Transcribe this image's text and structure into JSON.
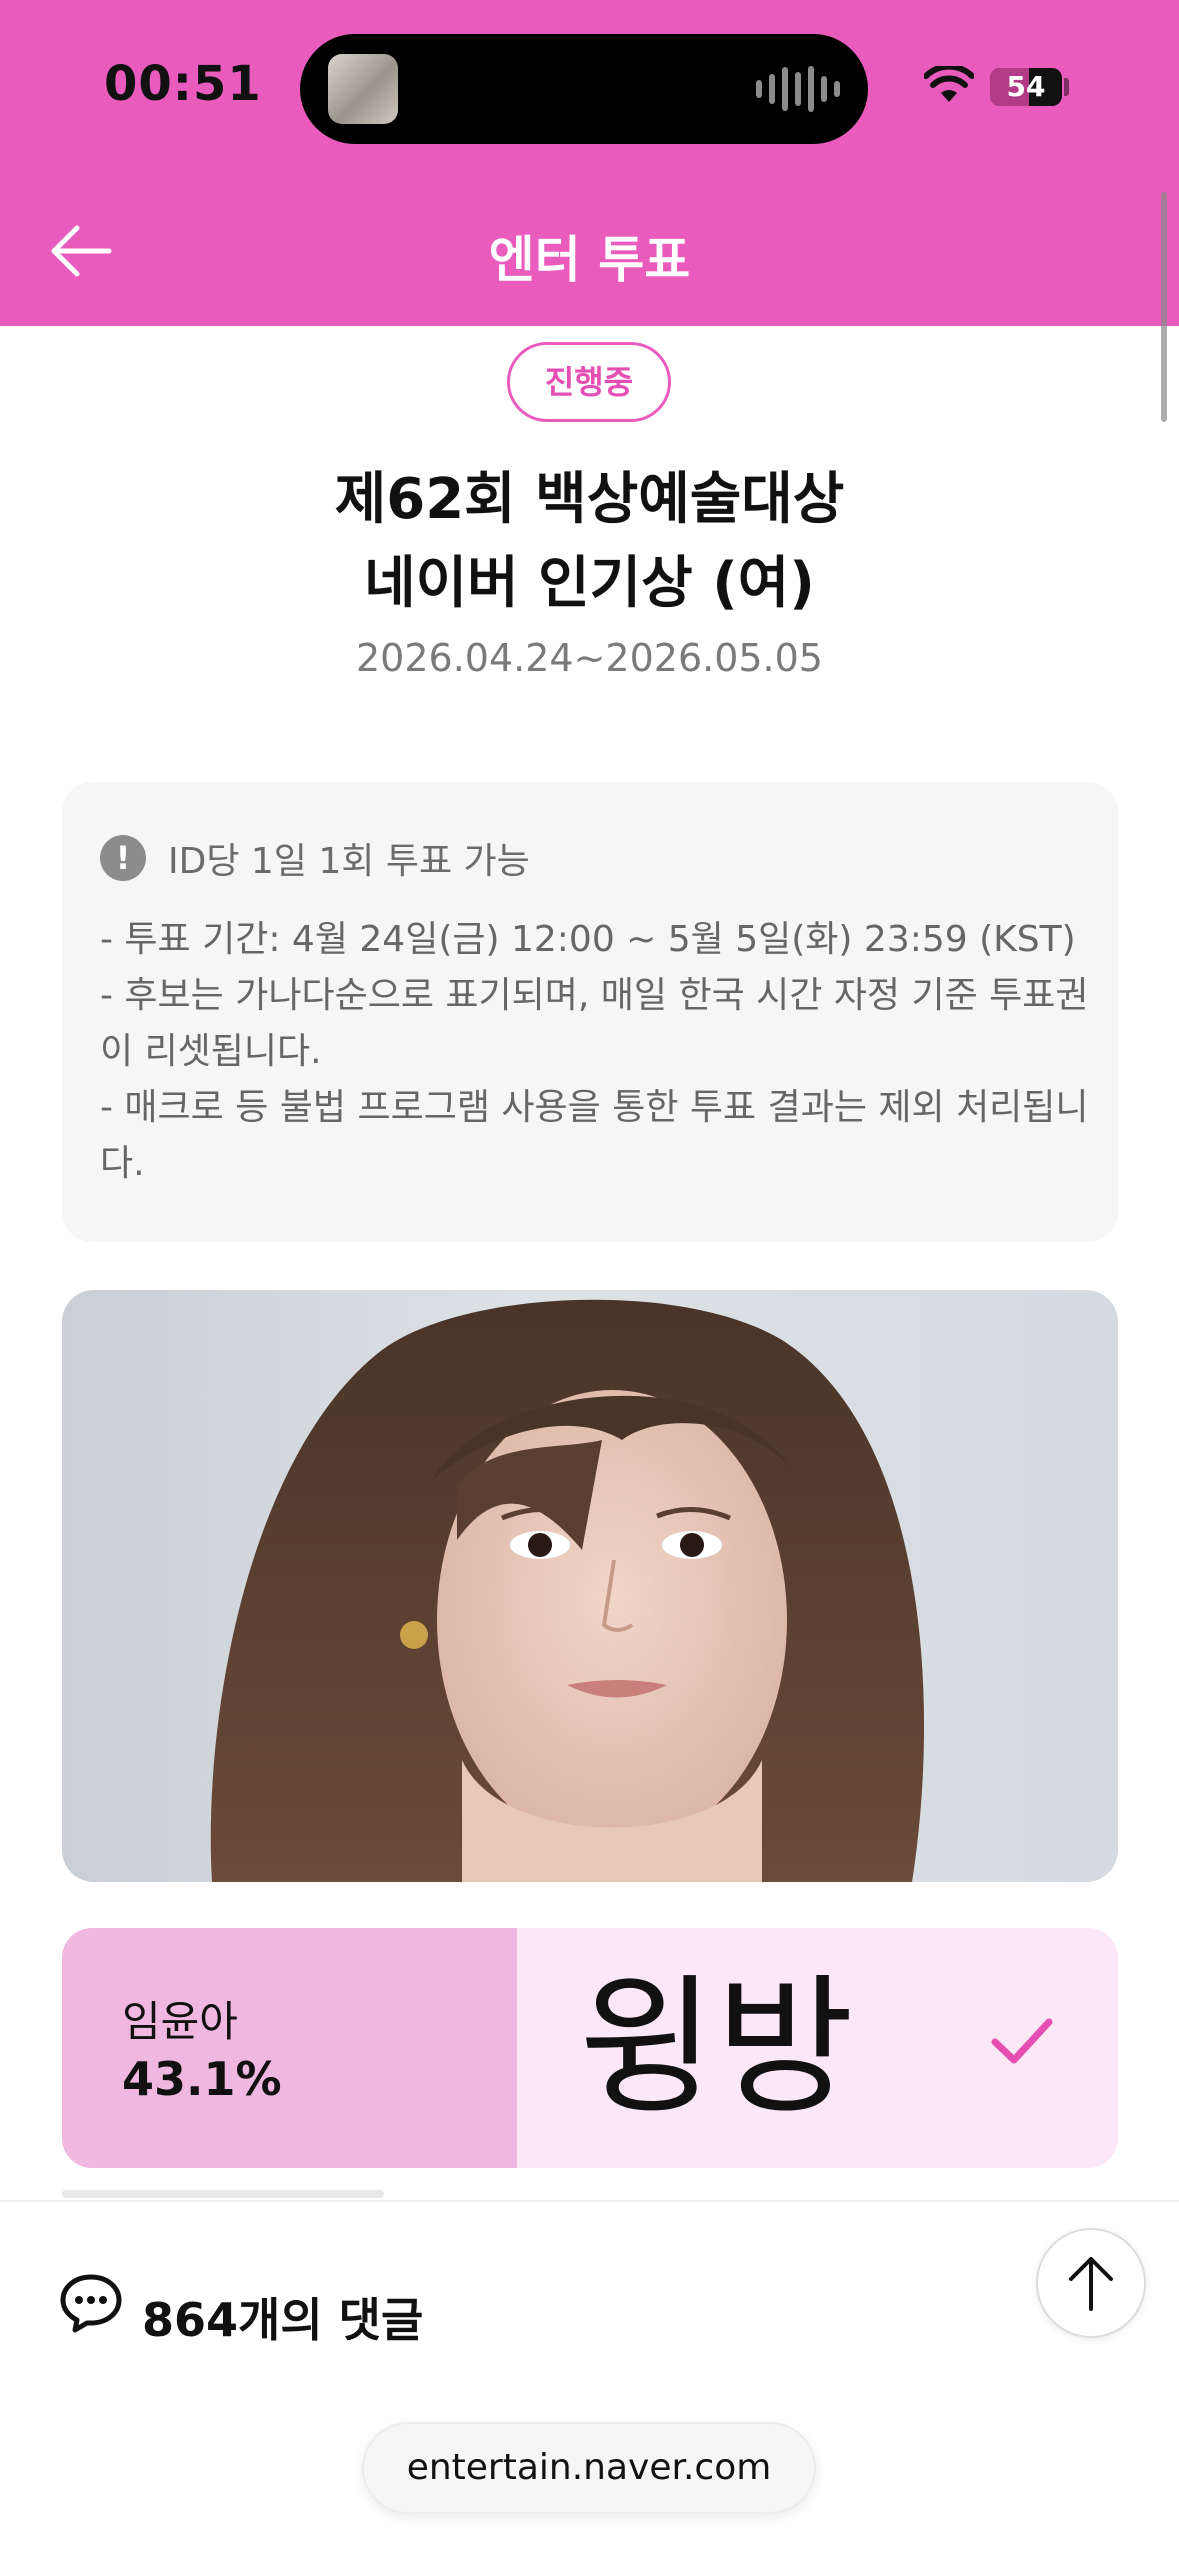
{
  "status_bar": {
    "time": "00:51",
    "battery": "54",
    "battery_level": 0.54
  },
  "header": {
    "title": "엔터 투표"
  },
  "vote": {
    "status": "진행중",
    "title_line1": "제62회 백상예술대상",
    "title_line2": "네이버 인기상 (여)",
    "date_range": "2026.04.24~2026.05.05"
  },
  "notice": {
    "headline": "ID당 1일 1회 투표 가능",
    "line1": "- 투표 기간: 4월 24일(금) 12:00 ~ 5월 5일(화) 23:59 (KST)",
    "line2": "- 후보는 가나다순으로 표기되며, 매일 한국 시간 자정 기준 투표권이 리셋됩니다.",
    "line3": "- 매크로 등 불법 프로그램 사용을 통한 투표 결과는 제외 처리됩니다."
  },
  "candidate": {
    "name": "임윤아",
    "percent": "43.1%",
    "share": 0.431,
    "ment": "윙방",
    "voted": true
  },
  "comments": {
    "label": "864개의 댓글"
  },
  "browser": {
    "url": "entertain.naver.com"
  },
  "colors": {
    "brand_pink": "#e95bbd",
    "result_fill": "#f0b8e0",
    "result_bg": "#fbe7f5"
  }
}
